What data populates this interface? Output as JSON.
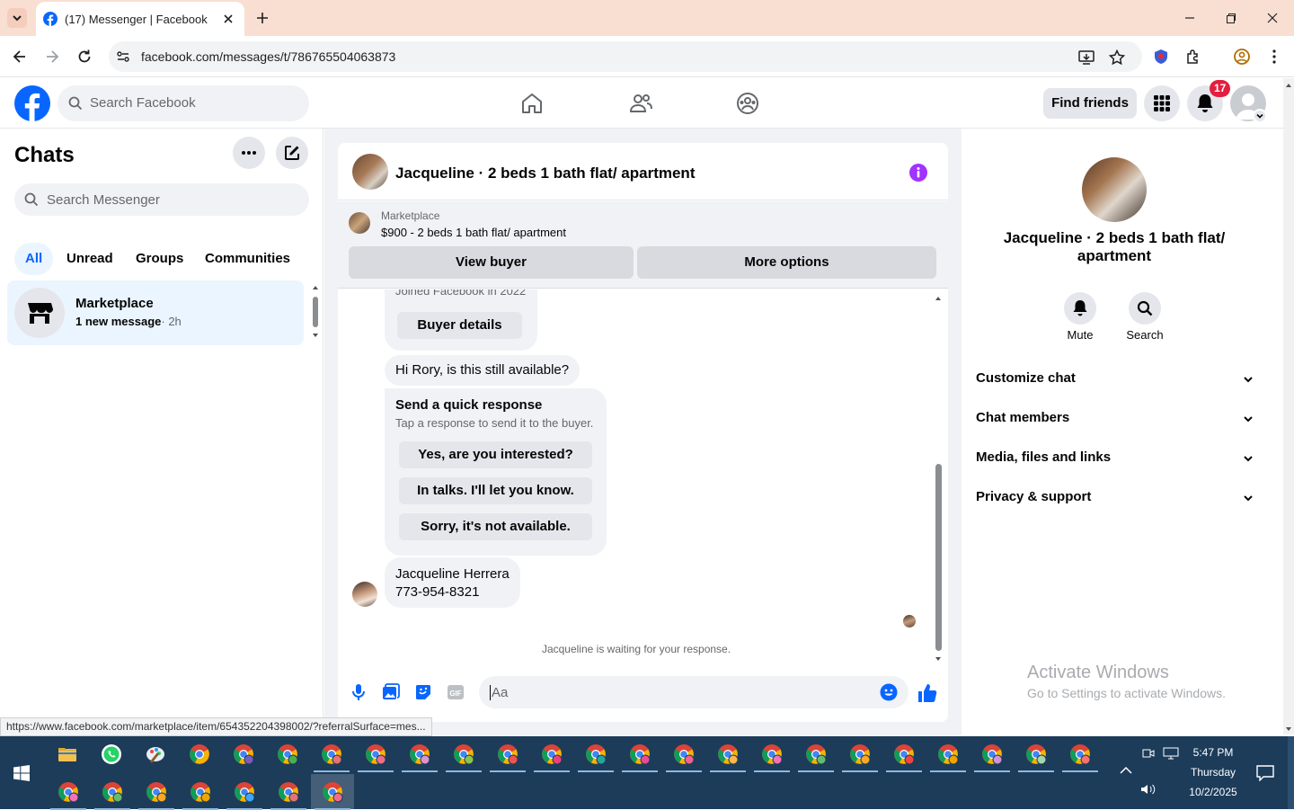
{
  "browser": {
    "tab_title": "(17) Messenger | Facebook",
    "url": "facebook.com/messages/t/786765504063873",
    "status_url": "https://www.facebook.com/marketplace/item/654352204398002/?referralSurface=mes..."
  },
  "header": {
    "search_placeholder": "Search Facebook",
    "find_friends": "Find friends",
    "notification_count": "17"
  },
  "chats": {
    "title": "Chats",
    "search_placeholder": "Search Messenger",
    "filters": [
      "All",
      "Unread",
      "Groups",
      "Communities"
    ],
    "items": [
      {
        "name": "Marketplace",
        "preview": "1 new message",
        "time": "· 2h"
      }
    ]
  },
  "conversation": {
    "title": "Jacqueline · 2 beds 1 bath flat/ apartment",
    "marketplace_label": "Marketplace",
    "listing": "$900 - 2 beds 1 bath flat/ apartment",
    "view_buyer": "View buyer",
    "more_options": "More options",
    "joined": "Joined Facebook in 2022",
    "buyer_details": "Buyer details",
    "message1": "Hi Rory, is this still available?",
    "quick_title": "Send a quick response",
    "quick_sub": "Tap a response to send it to the buyer.",
    "quick_responses": [
      "Yes, are you interested?",
      "In talks. I'll let you know.",
      "Sorry, it's not available."
    ],
    "contact_name": "Jacqueline Herrera",
    "contact_phone": "773-954-8321",
    "waiting": "Jacqueline is waiting for your response.",
    "composer_placeholder": "Aa"
  },
  "info": {
    "title": "Jacqueline · 2 beds 1 bath flat/ apartment",
    "mute": "Mute",
    "search": "Search",
    "sections": [
      "Customize chat",
      "Chat members",
      "Media, files and links",
      "Privacy & support"
    ],
    "watermark_title": "Activate Windows",
    "watermark_sub": "Go to Settings to activate Windows."
  },
  "taskbar": {
    "time": "5:47 PM",
    "day": "Thursday",
    "date": "10/2/2025"
  },
  "colors": {
    "fb_blue": "#0866ff",
    "accent_purple": "#a033ff",
    "badge_red": "#e41e3f",
    "taskbar": "#1c3c5a"
  }
}
